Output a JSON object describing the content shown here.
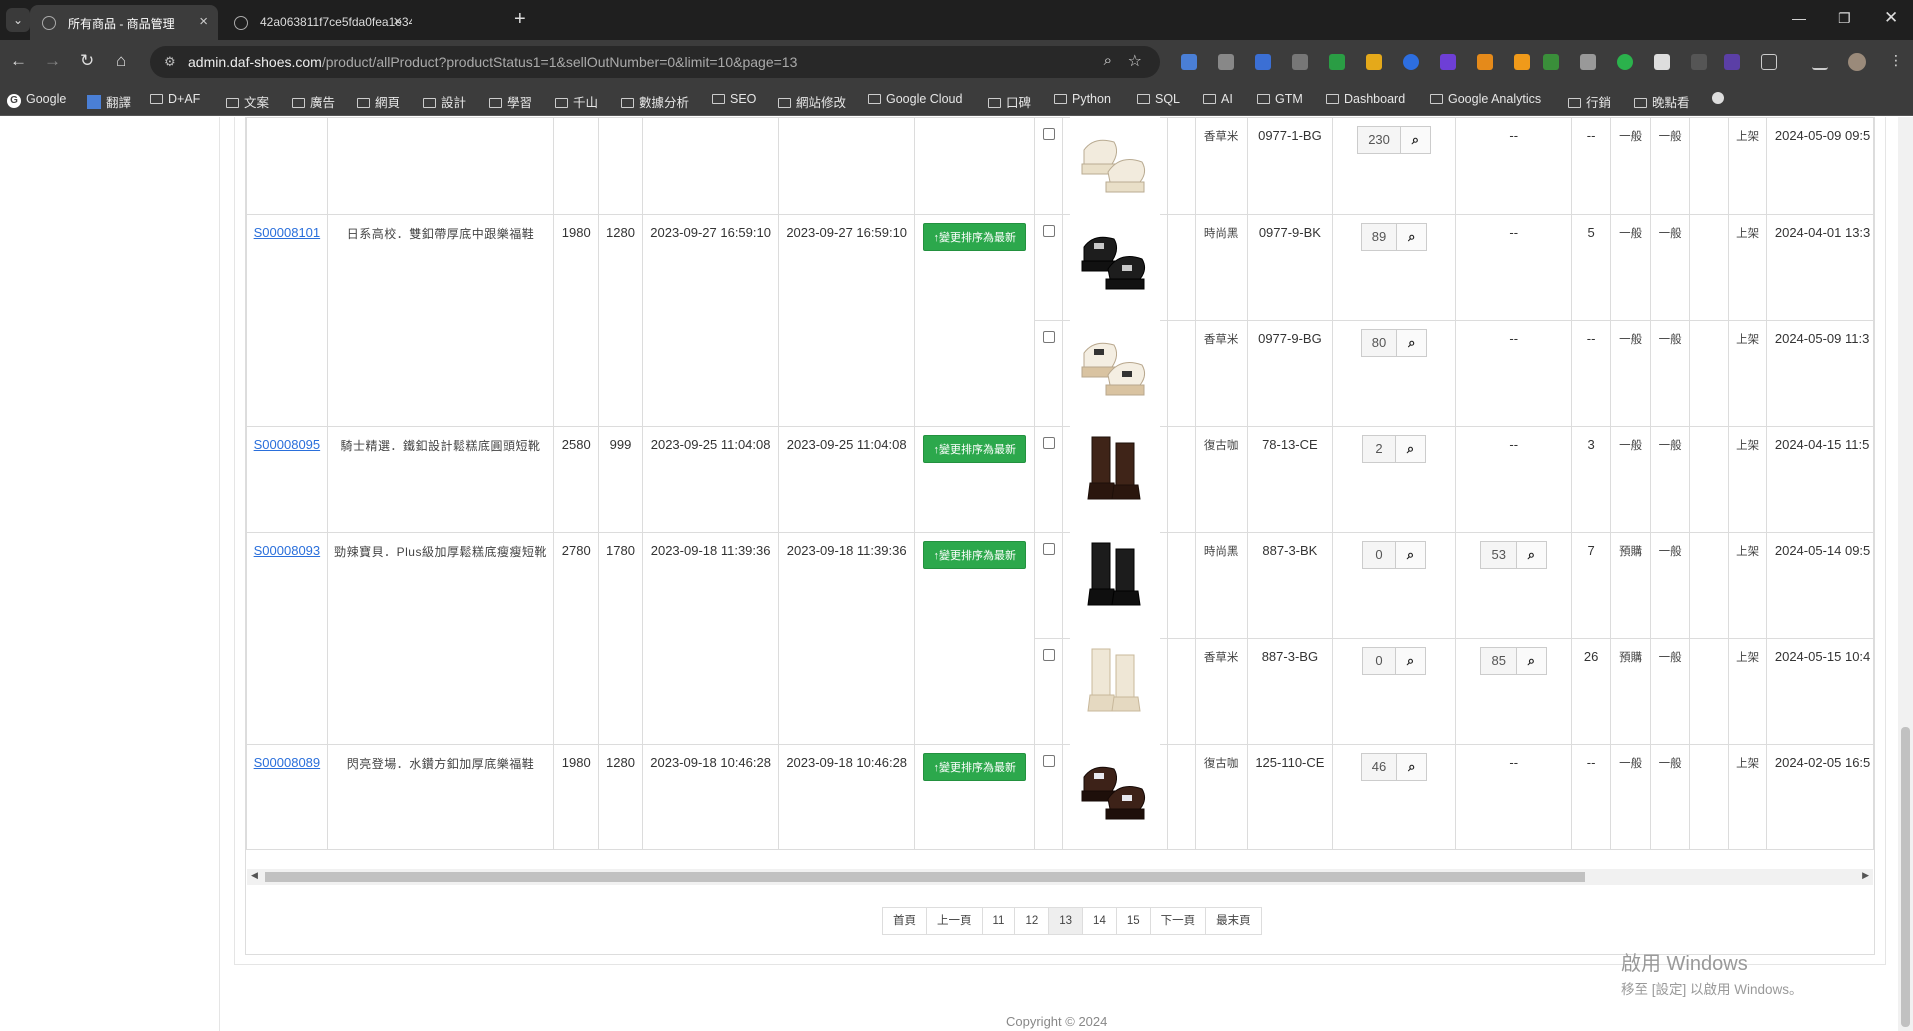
{
  "browser": {
    "tabs": [
      {
        "title": "所有商品 - 商品管理",
        "active": true
      },
      {
        "title": "42a063811f7ce5fda0fea1e34",
        "active": false
      }
    ],
    "url_host": "admin.daf-shoes.com",
    "url_path": "/product/allProduct?productStatus1=1&sellOutNumber=0&limit=10&page=13",
    "bookmarks": [
      "Google",
      "翻譯",
      "D+AF",
      "文案",
      "廣告",
      "網頁",
      "設計",
      "學習",
      "千山",
      "數據分析",
      "SEO",
      "網站修改",
      "Google Cloud",
      "口碑",
      "Python",
      "SQL",
      "AI",
      "GTM",
      "Dashboard",
      "Google Analytics",
      "行銷",
      "晚點看"
    ]
  },
  "table": {
    "sort_button_label": "↑變更排序為最新",
    "rows": [
      {
        "id": "",
        "name": "",
        "price": "",
        "sale": "",
        "created": "",
        "updated": "",
        "has_sort": false,
        "variants": [
          {
            "color": "香草米",
            "sku": "0977-1-BG",
            "stock": "230",
            "preorder": "",
            "preorder_label": "--",
            "sold": "--",
            "type1": "一般",
            "type2": "一般",
            "status": "上架",
            "date": "2024-05-09 09:5",
            "shoe": "white-loafer"
          }
        ]
      },
      {
        "id": "S00008101",
        "name": "日系高校．雙釦帶厚底中跟樂福鞋",
        "price": "1980",
        "sale": "1280",
        "created": "2023-09-27 16:59:10",
        "updated": "2023-09-27 16:59:10",
        "has_sort": true,
        "variants": [
          {
            "color": "時尚黑",
            "sku": "0977-9-BK",
            "stock": "89",
            "preorder": "",
            "preorder_label": "--",
            "sold": "5",
            "type1": "一般",
            "type2": "一般",
            "status": "上架",
            "date": "2024-04-01 13:3",
            "shoe": "black-buckle-loafer"
          },
          {
            "color": "香草米",
            "sku": "0977-9-BG",
            "stock": "80",
            "preorder": "",
            "preorder_label": "--",
            "sold": "--",
            "type1": "一般",
            "type2": "一般",
            "status": "上架",
            "date": "2024-05-09 11:3",
            "shoe": "white-buckle-loafer"
          }
        ]
      },
      {
        "id": "S00008095",
        "name": "騎士精選．鐵釦設計鬆糕底圓頭短靴",
        "price": "2580",
        "sale": "999",
        "created": "2023-09-25 11:04:08",
        "updated": "2023-09-25 11:04:08",
        "has_sort": true,
        "variants": [
          {
            "color": "復古咖",
            "sku": "78-13-CE",
            "stock": "2",
            "preorder": "",
            "preorder_label": "--",
            "sold": "3",
            "type1": "一般",
            "type2": "一般",
            "status": "上架",
            "date": "2024-04-15 11:5",
            "shoe": "brown-boot"
          }
        ]
      },
      {
        "id": "S00008093",
        "name": "勁辣寶貝．Plus級加厚鬆糕底瘦瘦短靴",
        "price": "2780",
        "sale": "1780",
        "created": "2023-09-18 11:39:36",
        "updated": "2023-09-18 11:39:36",
        "has_sort": true,
        "variants": [
          {
            "color": "時尚黑",
            "sku": "887-3-BK",
            "stock": "0",
            "preorder": "53",
            "preorder_label": "",
            "sold": "7",
            "type1": "預購",
            "type2": "一般",
            "status": "上架",
            "date": "2024-05-14 09:5",
            "shoe": "black-boot"
          },
          {
            "color": "香草米",
            "sku": "887-3-BG",
            "stock": "0",
            "preorder": "85",
            "preorder_label": "",
            "sold": "26",
            "type1": "預購",
            "type2": "一般",
            "status": "上架",
            "date": "2024-05-15 10:4",
            "shoe": "white-boot"
          }
        ]
      },
      {
        "id": "S00008089",
        "name": "閃亮登場．水鑽方釦加厚底樂福鞋",
        "price": "1980",
        "sale": "1280",
        "created": "2023-09-18 10:46:28",
        "updated": "2023-09-18 10:46:28",
        "has_sort": true,
        "variants": [
          {
            "color": "復古咖",
            "sku": "125-110-CE",
            "stock": "46",
            "preorder": "",
            "preorder_label": "--",
            "sold": "--",
            "type1": "一般",
            "type2": "一般",
            "status": "上架",
            "date": "2024-02-05 16:5",
            "shoe": "brown-jewel-loafer"
          }
        ]
      }
    ]
  },
  "pagination": [
    "首頁",
    "上一頁",
    "11",
    "12",
    "13",
    "14",
    "15",
    "下一頁",
    "最末頁"
  ],
  "pagination_active": "13",
  "footer": {
    "copyright": "Copyright © 2024"
  },
  "windows_activation": {
    "line1": "啟用 Windows",
    "line2": "移至 [設定] 以啟用 Windows。"
  },
  "colors": {
    "accent_green": "#2ca84c",
    "link_blue": "#2a6fdb"
  }
}
